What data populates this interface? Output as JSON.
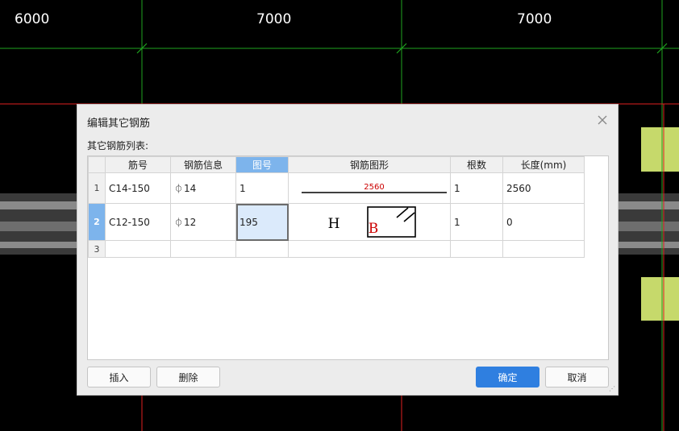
{
  "cad": {
    "dimensions": [
      "6000",
      "7000",
      "7000"
    ]
  },
  "dialog": {
    "title": "编辑其它钢筋",
    "list_label": "其它钢筋列表:",
    "columns": [
      "",
      "筋号",
      "钢筋信息",
      "图号",
      "钢筋图形",
      "根数",
      "长度(mm)"
    ],
    "selected_column": "图号",
    "rows": [
      {
        "index": "1",
        "bar_no": "C14-150",
        "steel_grade_icon": "hrb400-steel-symbol",
        "steel_info": "14",
        "figure_no": "1",
        "shape_label": "2560",
        "count": "1",
        "length": "2560"
      },
      {
        "index": "2",
        "bar_no": "C12-150",
        "steel_grade_icon": "hrb400-steel-symbol",
        "steel_info": "12",
        "figure_no": "195",
        "shape_h": "H",
        "shape_b": "B",
        "count": "1",
        "length": "0"
      },
      {
        "index": "3",
        "bar_no": "",
        "steel_info": "",
        "figure_no": "",
        "count": "",
        "length": ""
      }
    ],
    "buttons": {
      "insert": "插入",
      "delete": "删除",
      "ok": "确定",
      "cancel": "取消"
    },
    "colors": {
      "primary": "#2f7fe0",
      "selection": "#7db4ec",
      "shape_label_red": "#cc0000"
    }
  }
}
